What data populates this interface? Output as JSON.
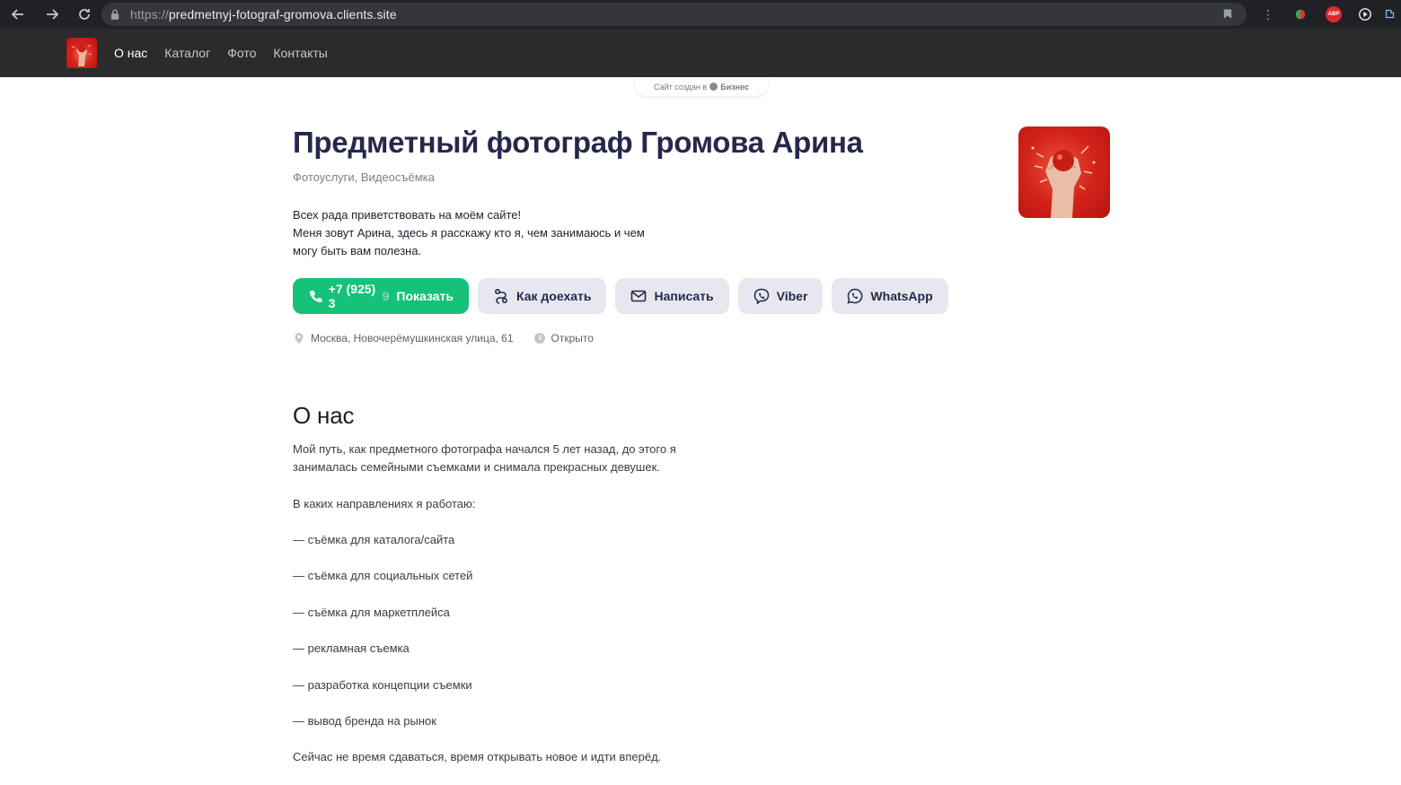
{
  "browser": {
    "url_scheme": "https://",
    "url_host": "predmetnyj-fotograf-gromova.clients.site",
    "abp_label": "ABP"
  },
  "header": {
    "nav": [
      {
        "label": "О нас",
        "active": true
      },
      {
        "label": "Каталог",
        "active": false
      },
      {
        "label": "Фото",
        "active": false
      },
      {
        "label": "Контакты",
        "active": false
      }
    ]
  },
  "badge": {
    "prefix": "Сайт создан в",
    "brand": "Бизнес"
  },
  "profile": {
    "title": "Предметный фотограф Громова Арина",
    "subtitle": "Фотоуслуги, Видеосъёмка",
    "intro_lines": [
      "Всех рада приветствовать на моём сайте!",
      "Меня зовут Арина, здесь я расскажу кто я, чем занимаюсь и чем",
      "могу быть вам полезна."
    ]
  },
  "actions": {
    "phone_visible": "+7 (925) 3",
    "phone_faded": "9",
    "phone_show": "Показать",
    "route": "Как доехать",
    "write": "Написать",
    "viber": "Viber",
    "whatsapp": "WhatsApp"
  },
  "meta": {
    "address": "Москва, Новочерёмушкинская улица, 61",
    "status": "Открыто"
  },
  "about": {
    "heading": "О нас",
    "paragraphs": [
      "Мой путь, как предметного фотографа начался 5 лет назад, до этого я занималась семейными съемками и снимала прекрасных девушек.",
      "В каких направлениях я работаю:",
      "— съёмка для каталога/сайта",
      "— съёмка для социальных сетей",
      "— съёмка для маркетплейса",
      "— рекламная съемка",
      "— разработка концепции съемки",
      "— вывод бренда на рынок",
      "Сейчас не время сдаваться, время открывать новое и идти вперёд."
    ]
  },
  "colors": {
    "accent_green": "#16c27a",
    "title_navy": "#25284a",
    "header_bg": "#2b2b2d",
    "chrome_bg": "#202124"
  }
}
